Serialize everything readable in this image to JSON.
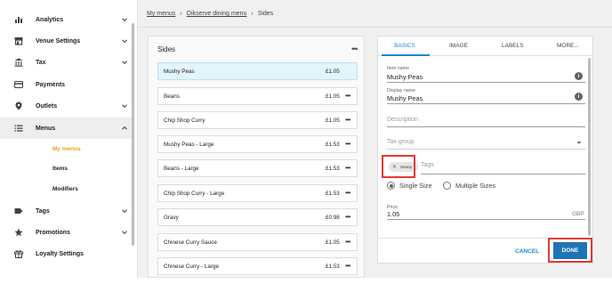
{
  "sidebar": {
    "items": [
      {
        "label": "Analytics",
        "icon": "bar-chart-icon",
        "expandable": true
      },
      {
        "label": "Venue Settings",
        "icon": "store-icon",
        "expandable": true
      },
      {
        "label": "Tax",
        "icon": "bank-icon",
        "expandable": true
      },
      {
        "label": "Payments",
        "icon": "credit-card-icon",
        "expandable": false
      },
      {
        "label": "Outlets",
        "icon": "location-pin-icon",
        "expandable": true
      },
      {
        "label": "Menus",
        "icon": "list-icon",
        "expandable": true,
        "expanded": true
      },
      {
        "label": "Tags",
        "icon": "tag-icon",
        "expandable": true
      },
      {
        "label": "Promotions",
        "icon": "star-icon",
        "expandable": true
      },
      {
        "label": "Loyalty Settings",
        "icon": "gift-icon",
        "expandable": false
      }
    ],
    "menus_subitems": [
      "My menus",
      "Items",
      "Modifiers"
    ],
    "current_subitem": "My menus"
  },
  "breadcrumb": {
    "items": [
      "My menus",
      "Oikserve dining menu",
      "Sides"
    ]
  },
  "sides": {
    "title": "Sides",
    "more": "•••",
    "row_more": "•••",
    "items": [
      {
        "name": "Mushy Peas",
        "price": "£1.05",
        "selected": true
      },
      {
        "name": "Beans",
        "price": "£1.05"
      },
      {
        "name": "Chip Shop Curry",
        "price": "£1.05"
      },
      {
        "name": "Mushy Peas - Large",
        "price": "£1.53"
      },
      {
        "name": "Beans - Large",
        "price": "£1.53"
      },
      {
        "name": "Chip Shop Curry - Large",
        "price": "£1.53"
      },
      {
        "name": "Gravy",
        "price": "£0.98"
      },
      {
        "name": "Chinese Curry Sauce",
        "price": "£1.05"
      },
      {
        "name": "Chinese Curry - Large",
        "price": "£1.53"
      }
    ]
  },
  "editor": {
    "tabs": [
      "BASICS",
      "IMAGE",
      "LABELS",
      "MORE..."
    ],
    "active_tab": "BASICS",
    "item_name_label": "Item name",
    "item_name_value": "Mushy Peas",
    "display_name_label": "Display name",
    "display_name_value": "Mushy Peas",
    "description_placeholder": "Description",
    "tax_group_placeholder": "Tax group",
    "tags_placeholder": "Tags",
    "tag_chip": "Stamp",
    "size_options": [
      "Single Size",
      "Multiple Sizes"
    ],
    "selected_size": "Single Size",
    "price_label": "Price",
    "price_value": "1.05",
    "currency": "GBP",
    "cancel_label": "CANCEL",
    "done_label": "DONE",
    "accent_color": "#1e88c7",
    "highlight_color": "#e53935"
  }
}
